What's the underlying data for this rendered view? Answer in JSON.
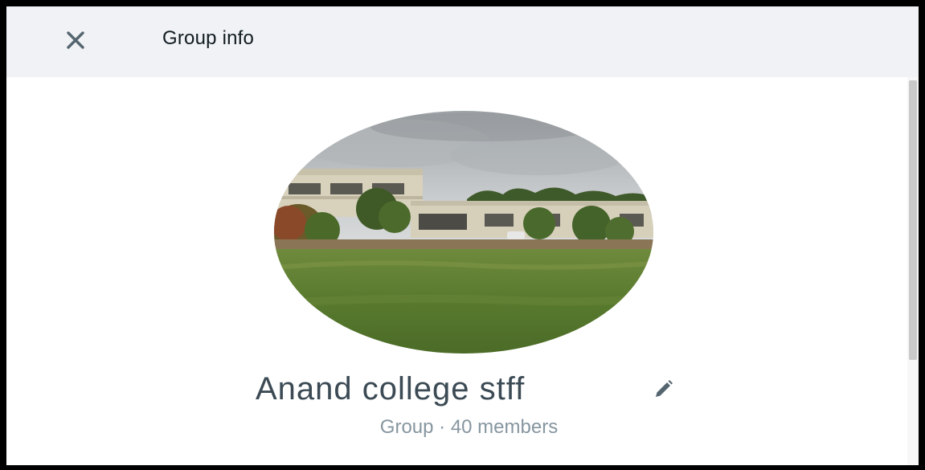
{
  "header": {
    "title": "Group info",
    "close_icon": "close-icon"
  },
  "profile": {
    "image_description": "group-photo",
    "name": "Anand college stff",
    "edit_icon": "pencil-icon",
    "meta": "Group · 40 members"
  },
  "colors": {
    "header_bg": "#f0f2f5",
    "title_text": "#111b21",
    "name_text": "#3b4a54",
    "meta_text": "#8696a0",
    "icon": "#54656f"
  }
}
